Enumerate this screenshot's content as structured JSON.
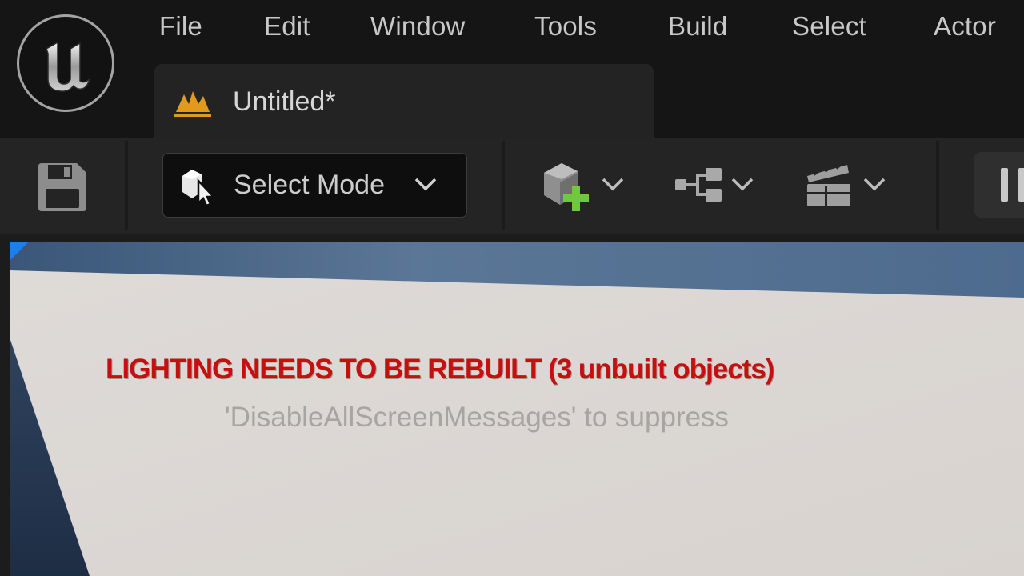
{
  "app": {
    "logo": "unreal-engine-logo-icon"
  },
  "menu": {
    "items": [
      "File",
      "Edit",
      "Window",
      "Tools",
      "Build",
      "Select",
      "Actor"
    ]
  },
  "tab": {
    "label": "Untitled*",
    "icon": "level-icon"
  },
  "toolbar": {
    "save_icon": "save-icon",
    "mode_label": "Select Mode",
    "mode_icon": "select-mode-icon",
    "buttons": [
      "add-actor-icon",
      "blueprint-icon",
      "cinematics-icon"
    ]
  },
  "viewport": {
    "warning": "LIGHTING NEEDS TO BE REBUILT (3 unbuilt objects)",
    "hint": "'DisableAllScreenMessages' to suppress"
  },
  "colors": {
    "warning_text": "#c60f0f",
    "accent_orange": "#e39a1c",
    "add_green": "#6fc93b",
    "viewport_corner": "#1f7fe8"
  }
}
